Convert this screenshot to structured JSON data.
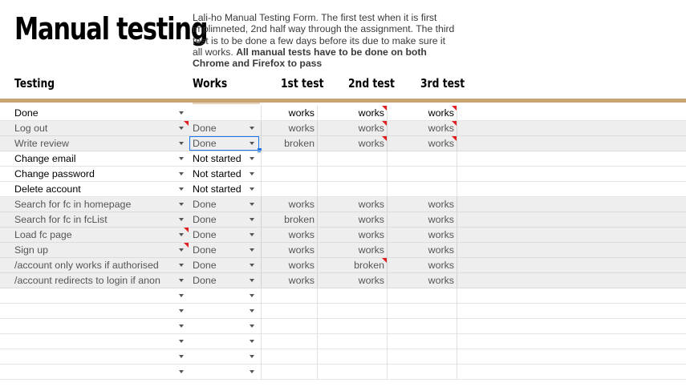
{
  "sheet": {
    "title": "Manual testing",
    "description_plain": "Lali-ho Manual Testing Form. The first test when it is first implimneted, 2nd half way through the assignment.  The third test is to be done a few days before its due to make sure it all works.",
    "description_bold": "All manual tests have to be done on both Chrome and Firefox to pass"
  },
  "columns": {
    "testing": "Testing",
    "works": "Works",
    "test1": "1st test",
    "test2": "2nd test",
    "test3": "3rd test"
  },
  "accent_colors": {
    "header_bar": "#c9a373",
    "note_marker": "#e02020",
    "selection": "#1a73e8"
  },
  "rows": [
    {
      "test": "Done",
      "works": "",
      "t1": "works",
      "t2": "works",
      "t3": "works",
      "gray": false,
      "notes": [
        "t2",
        "t3"
      ]
    },
    {
      "test": "Log out",
      "works": "Done",
      "t1": "works",
      "t2": "works",
      "t3": "works",
      "gray": true,
      "notes": [
        "test",
        "t2",
        "t3"
      ]
    },
    {
      "test": "Write review",
      "works": "Done",
      "t1": "broken",
      "t2": "works",
      "t3": "works",
      "gray": true,
      "notes": [
        "t2",
        "t3"
      ],
      "selected": true
    },
    {
      "test": "Change email",
      "works": "Not started",
      "t1": "",
      "t2": "",
      "t3": "",
      "gray": false,
      "notes": []
    },
    {
      "test": "Change password",
      "works": "Not started",
      "t1": "",
      "t2": "",
      "t3": "",
      "gray": false,
      "notes": []
    },
    {
      "test": "Delete account",
      "works": "Not started",
      "t1": "",
      "t2": "",
      "t3": "",
      "gray": false,
      "notes": []
    },
    {
      "test": "Search for fc in homepage",
      "works": "Done",
      "t1": "works",
      "t2": "works",
      "t3": "works",
      "gray": true,
      "notes": []
    },
    {
      "test": "Search for fc in fcList",
      "works": "Done",
      "t1": "broken",
      "t2": "works",
      "t3": "works",
      "gray": true,
      "notes": []
    },
    {
      "test": "Load fc page",
      "works": "Done",
      "t1": "works",
      "t2": "works",
      "t3": "works",
      "gray": true,
      "notes": [
        "test"
      ]
    },
    {
      "test": "Sign up",
      "works": "Done",
      "t1": "works",
      "t2": "works",
      "t3": "works",
      "gray": true,
      "notes": [
        "test"
      ]
    },
    {
      "test": "/account only works if authorised",
      "works": "Done",
      "t1": "works",
      "t2": "broken",
      "t3": "works",
      "gray": true,
      "notes": [
        "t2"
      ]
    },
    {
      "test": "/account redirects to login if anon",
      "works": "Done",
      "t1": "works",
      "t2": "works",
      "t3": "works",
      "gray": true,
      "notes": []
    },
    {
      "test": "",
      "works": "",
      "t1": "",
      "t2": "",
      "t3": "",
      "gray": false,
      "notes": []
    },
    {
      "test": "",
      "works": "",
      "t1": "",
      "t2": "",
      "t3": "",
      "gray": false,
      "notes": []
    },
    {
      "test": "",
      "works": "",
      "t1": "",
      "t2": "",
      "t3": "",
      "gray": false,
      "notes": []
    },
    {
      "test": "",
      "works": "",
      "t1": "",
      "t2": "",
      "t3": "",
      "gray": false,
      "notes": []
    },
    {
      "test": "",
      "works": "",
      "t1": "",
      "t2": "",
      "t3": "",
      "gray": false,
      "notes": []
    },
    {
      "test": "",
      "works": "",
      "t1": "",
      "t2": "",
      "t3": "",
      "gray": false,
      "notes": []
    }
  ]
}
